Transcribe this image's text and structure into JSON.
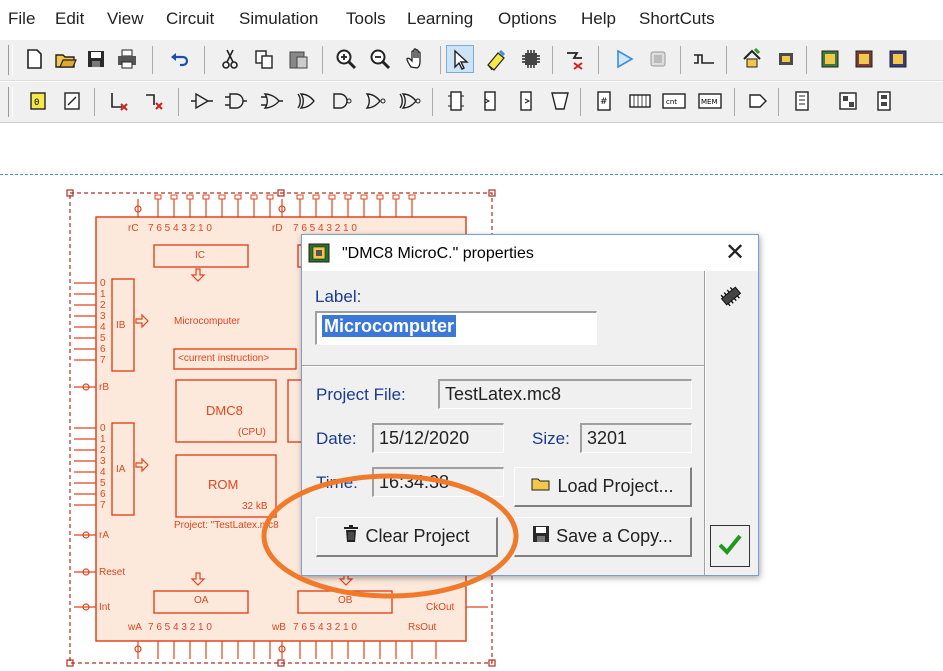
{
  "menu": {
    "items": [
      "File",
      "Edit",
      "View",
      "Circuit",
      "Simulation",
      "Tools",
      "Learning",
      "Options",
      "Help",
      "ShortCuts"
    ]
  },
  "toolbar1": {
    "icons": [
      "new-file-icon",
      "open-folder-icon",
      "save-icon",
      "print-icon",
      "undo-icon",
      "cut-icon",
      "copy-icon",
      "paste-icon",
      "zoom-in-icon",
      "zoom-out-icon",
      "pan-hand-icon",
      "select-arrow-icon",
      "eraser-icon",
      "chip-edit-icon",
      "wire-probe-icon",
      "run-icon",
      "stop-icon",
      "signal-icon",
      "home-chip-icon",
      "chip-a-icon",
      "chip-b-icon",
      "chip-c-icon",
      "chip-d-icon"
    ]
  },
  "toolbar2": {
    "icons": [
      "logic-icon-1",
      "logic-icon-2",
      "delete-wire-icon",
      "delete-pin-icon",
      "buffer-gate-icon",
      "and-gate-icon",
      "or-gate-icon",
      "xor-gate-icon",
      "nand-gate-icon",
      "nor-gate-icon",
      "xnor-gate-icon",
      "flipflop-icon-1",
      "flipflop-icon-2",
      "flipflop-icon-3",
      "flipflop-icon-4",
      "counter-icon",
      "register-icon",
      "cnt-icon",
      "mem-icon",
      "display-icon",
      "decoder-icon",
      "keypad-icon",
      "ic-icon"
    ]
  },
  "circuit": {
    "title_label": "Microcomputer",
    "current_instruction": "<current instruction>",
    "cpu_label": "DMC8",
    "cpu_sub": "(CPU)",
    "rom_label": "ROM",
    "rom_size": "32 kB",
    "project_label": "Project: \"TestLatex.mc8",
    "ic_label": "IC",
    "ib_label": "IB",
    "ia_label": "IA",
    "oa_label": "OA",
    "ob_label": "OB",
    "bits": "7 6 5 4 3 2 1 0",
    "rc_label": "rC",
    "rd_label": "rD",
    "rb_label": "rB",
    "ra_label": "rA",
    "wa_label": "wA",
    "wb_label": "wB",
    "reset_label": "Reset",
    "int_label": "Int",
    "ckout_label": "CkOut",
    "rsout_label": "RsOut",
    "pins": [
      "0",
      "1",
      "2",
      "3",
      "4",
      "5",
      "6",
      "7"
    ]
  },
  "dialog": {
    "title": "\"DMC8 MicroC.\" properties",
    "close": "✕",
    "label_caption": "Label:",
    "label_value": "Microcomputer",
    "project_file_caption": "Project File:",
    "project_file_value": "TestLatex.mc8",
    "date_caption": "Date:",
    "date_value": "15/12/2020",
    "size_caption": "Size:",
    "size_value": "3201",
    "time_caption": "Time:",
    "time_value": "16:34:38",
    "load_button": "Load Project...",
    "clear_button": "Clear Project",
    "save_copy_button": "Save a Copy..."
  },
  "colors": {
    "circuit": "#e0461e",
    "circuit_fill": "#fde8dc",
    "annotation": "#f07a2a",
    "selection": "#3b78d8",
    "label_text": "#1a3b8f",
    "ok_check": "#1f9a1f"
  }
}
